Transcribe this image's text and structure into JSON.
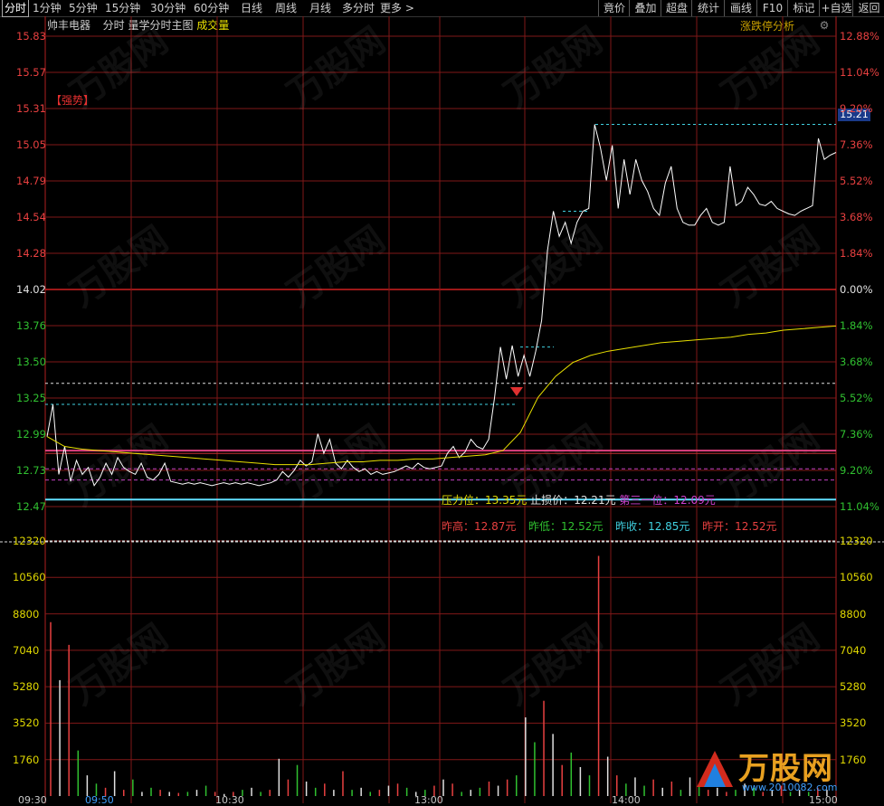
{
  "toolbar": {
    "periods": [
      "分时",
      "1分钟",
      "5分钟",
      "15分钟",
      "30分钟",
      "60分钟",
      "日线",
      "周线",
      "月线",
      "多分时",
      "更多 >"
    ],
    "right_buttons": [
      "竟价",
      "叠加",
      "超盘",
      "统计",
      "画线",
      "F10",
      "标记",
      "+自选",
      "返回"
    ]
  },
  "header": {
    "stock_name": "帅丰电器",
    "chart_title": "分时 量学分时主图",
    "volume_label": "成交量",
    "analysis_label": "涨跌停分析",
    "strong_badge": "【强势】",
    "current_price_tag": "15.21"
  },
  "info": {
    "pressure": {
      "label": "压力位：",
      "value": "13.35元"
    },
    "stop_loss": {
      "label": "止损价：",
      "value": "12.21元"
    },
    "third": {
      "label": "第三一位：",
      "value": "12.09元"
    },
    "prev_high": {
      "label": "昨高：",
      "value": "12.87元"
    },
    "prev_low": {
      "label": "昨低：",
      "value": "12.52元"
    },
    "prev_close": {
      "label": "昨收：",
      "value": "12.85元"
    },
    "prev_open": {
      "label": "昨开：",
      "value": "12.52元"
    }
  },
  "chart_data": [
    {
      "type": "line",
      "name": "price-pane",
      "y_ticks_left": [
        "15.83",
        "15.57",
        "15.31",
        "15.05",
        "14.79",
        "14.54",
        "14.28",
        "14.02",
        "13.76",
        "13.50",
        "13.25",
        "12.99",
        "12.73",
        "12.47"
      ],
      "y_ticks_right": [
        "12.88%",
        "11.04%",
        "9.20%",
        "7.36%",
        "5.52%",
        "3.68%",
        "1.84%",
        "0.00%",
        "1.84%",
        "3.68%",
        "5.52%",
        "7.36%",
        "9.20%",
        "11.04%"
      ],
      "ylim": [
        12.47,
        15.83
      ],
      "x_ticks": [
        "09:30",
        "09:50",
        "10:30",
        "13:00",
        "14:00",
        "15:00"
      ],
      "price_series": [
        12.97,
        13.2,
        12.7,
        12.9,
        12.65,
        12.8,
        12.7,
        12.75,
        12.62,
        12.68,
        12.78,
        12.7,
        12.82,
        12.75,
        12.72,
        12.7,
        12.78,
        12.68,
        12.66,
        12.7,
        12.78,
        12.65,
        12.64,
        12.63,
        12.64,
        12.63,
        12.64,
        12.63,
        12.62,
        12.63,
        12.64,
        12.63,
        12.64,
        12.63,
        12.64,
        12.63,
        12.62,
        12.63,
        12.64,
        12.66,
        12.72,
        12.68,
        12.73,
        12.8,
        12.76,
        12.79,
        12.99,
        12.85,
        12.95,
        12.78,
        12.74,
        12.8,
        12.75,
        12.72,
        12.74,
        12.7,
        12.72,
        12.7,
        12.71,
        12.72,
        12.74,
        12.76,
        12.74,
        12.78,
        12.75,
        12.74,
        12.75,
        12.76,
        12.85,
        12.9,
        12.82,
        12.86,
        12.95,
        12.9,
        12.88,
        12.95,
        13.25,
        13.61,
        13.38,
        13.62,
        13.4,
        13.55,
        13.4,
        13.58,
        13.8,
        14.3,
        14.58,
        14.4,
        14.5,
        14.35,
        14.5,
        14.58,
        14.6,
        15.2,
        15.03,
        14.8,
        15.05,
        14.6,
        14.95,
        14.7,
        14.95,
        14.8,
        14.72,
        14.6,
        14.55,
        14.78,
        14.9,
        14.6,
        14.5,
        14.48,
        14.48,
        14.55,
        14.6,
        14.5,
        14.48,
        14.5,
        14.9,
        14.62,
        14.65,
        14.75,
        14.7,
        14.63,
        14.62,
        14.65,
        14.6,
        14.58,
        14.56,
        14.55,
        14.58,
        14.6,
        14.62,
        15.1,
        14.95,
        14.98,
        15.0
      ],
      "avg_series": [
        12.97,
        12.9,
        12.88,
        12.87,
        12.86,
        12.85,
        12.84,
        12.83,
        12.82,
        12.81,
        12.8,
        12.79,
        12.78,
        12.77,
        12.77,
        12.77,
        12.78,
        12.79,
        12.79,
        12.8,
        12.8,
        12.81,
        12.81,
        12.82,
        12.83,
        12.84,
        12.87,
        13.0,
        13.25,
        13.4,
        13.5,
        13.55,
        13.58,
        13.6,
        13.62,
        13.64,
        13.65,
        13.66,
        13.67,
        13.68,
        13.7,
        13.71,
        13.73,
        13.74,
        13.75,
        13.76
      ]
    },
    {
      "type": "bar",
      "name": "volume-pane",
      "y_ticks": [
        "12320",
        "10560",
        "8800",
        "7040",
        "5280",
        "3520",
        "1760"
      ],
      "ylim": [
        0,
        12320
      ],
      "values": [
        8400,
        5600,
        7300,
        2200,
        1000,
        600,
        400,
        1200,
        300,
        800,
        200,
        400,
        300,
        200,
        150,
        200,
        300,
        500,
        200,
        100,
        200,
        300,
        400,
        200,
        300,
        1800,
        800,
        1500,
        700,
        400,
        600,
        300,
        1200,
        300,
        400,
        200,
        300,
        500,
        600,
        400,
        200,
        300,
        500,
        800,
        600,
        200,
        300,
        400,
        700,
        500,
        800,
        1000,
        3800,
        2600,
        4600,
        3000,
        1500,
        2100,
        1400,
        1000,
        11600,
        1900,
        1000,
        600,
        900,
        500,
        800,
        400,
        700,
        300,
        900,
        500,
        300,
        400,
        200,
        300,
        600,
        400,
        200,
        300,
        500,
        200,
        300,
        200,
        400,
        300
      ]
    }
  ]
}
